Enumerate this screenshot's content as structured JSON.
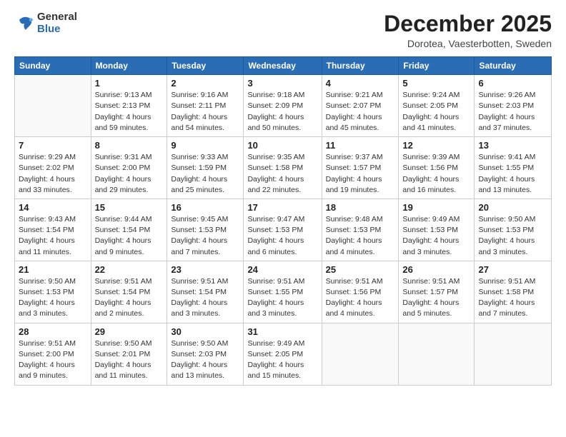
{
  "logo": {
    "general": "General",
    "blue": "Blue"
  },
  "title": "December 2025",
  "subtitle": "Dorotea, Vaesterbotten, Sweden",
  "days_of_week": [
    "Sunday",
    "Monday",
    "Tuesday",
    "Wednesday",
    "Thursday",
    "Friday",
    "Saturday"
  ],
  "weeks": [
    [
      {
        "day": "",
        "info": ""
      },
      {
        "day": "1",
        "info": "Sunrise: 9:13 AM\nSunset: 2:13 PM\nDaylight: 4 hours\nand 59 minutes."
      },
      {
        "day": "2",
        "info": "Sunrise: 9:16 AM\nSunset: 2:11 PM\nDaylight: 4 hours\nand 54 minutes."
      },
      {
        "day": "3",
        "info": "Sunrise: 9:18 AM\nSunset: 2:09 PM\nDaylight: 4 hours\nand 50 minutes."
      },
      {
        "day": "4",
        "info": "Sunrise: 9:21 AM\nSunset: 2:07 PM\nDaylight: 4 hours\nand 45 minutes."
      },
      {
        "day": "5",
        "info": "Sunrise: 9:24 AM\nSunset: 2:05 PM\nDaylight: 4 hours\nand 41 minutes."
      },
      {
        "day": "6",
        "info": "Sunrise: 9:26 AM\nSunset: 2:03 PM\nDaylight: 4 hours\nand 37 minutes."
      }
    ],
    [
      {
        "day": "7",
        "info": "Sunrise: 9:29 AM\nSunset: 2:02 PM\nDaylight: 4 hours\nand 33 minutes."
      },
      {
        "day": "8",
        "info": "Sunrise: 9:31 AM\nSunset: 2:00 PM\nDaylight: 4 hours\nand 29 minutes."
      },
      {
        "day": "9",
        "info": "Sunrise: 9:33 AM\nSunset: 1:59 PM\nDaylight: 4 hours\nand 25 minutes."
      },
      {
        "day": "10",
        "info": "Sunrise: 9:35 AM\nSunset: 1:58 PM\nDaylight: 4 hours\nand 22 minutes."
      },
      {
        "day": "11",
        "info": "Sunrise: 9:37 AM\nSunset: 1:57 PM\nDaylight: 4 hours\nand 19 minutes."
      },
      {
        "day": "12",
        "info": "Sunrise: 9:39 AM\nSunset: 1:56 PM\nDaylight: 4 hours\nand 16 minutes."
      },
      {
        "day": "13",
        "info": "Sunrise: 9:41 AM\nSunset: 1:55 PM\nDaylight: 4 hours\nand 13 minutes."
      }
    ],
    [
      {
        "day": "14",
        "info": "Sunrise: 9:43 AM\nSunset: 1:54 PM\nDaylight: 4 hours\nand 11 minutes."
      },
      {
        "day": "15",
        "info": "Sunrise: 9:44 AM\nSunset: 1:54 PM\nDaylight: 4 hours\nand 9 minutes."
      },
      {
        "day": "16",
        "info": "Sunrise: 9:45 AM\nSunset: 1:53 PM\nDaylight: 4 hours\nand 7 minutes."
      },
      {
        "day": "17",
        "info": "Sunrise: 9:47 AM\nSunset: 1:53 PM\nDaylight: 4 hours\nand 6 minutes."
      },
      {
        "day": "18",
        "info": "Sunrise: 9:48 AM\nSunset: 1:53 PM\nDaylight: 4 hours\nand 4 minutes."
      },
      {
        "day": "19",
        "info": "Sunrise: 9:49 AM\nSunset: 1:53 PM\nDaylight: 4 hours\nand 3 minutes."
      },
      {
        "day": "20",
        "info": "Sunrise: 9:50 AM\nSunset: 1:53 PM\nDaylight: 4 hours\nand 3 minutes."
      }
    ],
    [
      {
        "day": "21",
        "info": "Sunrise: 9:50 AM\nSunset: 1:53 PM\nDaylight: 4 hours\nand 3 minutes."
      },
      {
        "day": "22",
        "info": "Sunrise: 9:51 AM\nSunset: 1:54 PM\nDaylight: 4 hours\nand 2 minutes."
      },
      {
        "day": "23",
        "info": "Sunrise: 9:51 AM\nSunset: 1:54 PM\nDaylight: 4 hours\nand 3 minutes."
      },
      {
        "day": "24",
        "info": "Sunrise: 9:51 AM\nSunset: 1:55 PM\nDaylight: 4 hours\nand 3 minutes."
      },
      {
        "day": "25",
        "info": "Sunrise: 9:51 AM\nSunset: 1:56 PM\nDaylight: 4 hours\nand 4 minutes."
      },
      {
        "day": "26",
        "info": "Sunrise: 9:51 AM\nSunset: 1:57 PM\nDaylight: 4 hours\nand 5 minutes."
      },
      {
        "day": "27",
        "info": "Sunrise: 9:51 AM\nSunset: 1:58 PM\nDaylight: 4 hours\nand 7 minutes."
      }
    ],
    [
      {
        "day": "28",
        "info": "Sunrise: 9:51 AM\nSunset: 2:00 PM\nDaylight: 4 hours\nand 9 minutes."
      },
      {
        "day": "29",
        "info": "Sunrise: 9:50 AM\nSunset: 2:01 PM\nDaylight: 4 hours\nand 11 minutes."
      },
      {
        "day": "30",
        "info": "Sunrise: 9:50 AM\nSunset: 2:03 PM\nDaylight: 4 hours\nand 13 minutes."
      },
      {
        "day": "31",
        "info": "Sunrise: 9:49 AM\nSunset: 2:05 PM\nDaylight: 4 hours\nand 15 minutes."
      },
      {
        "day": "",
        "info": ""
      },
      {
        "day": "",
        "info": ""
      },
      {
        "day": "",
        "info": ""
      }
    ]
  ]
}
